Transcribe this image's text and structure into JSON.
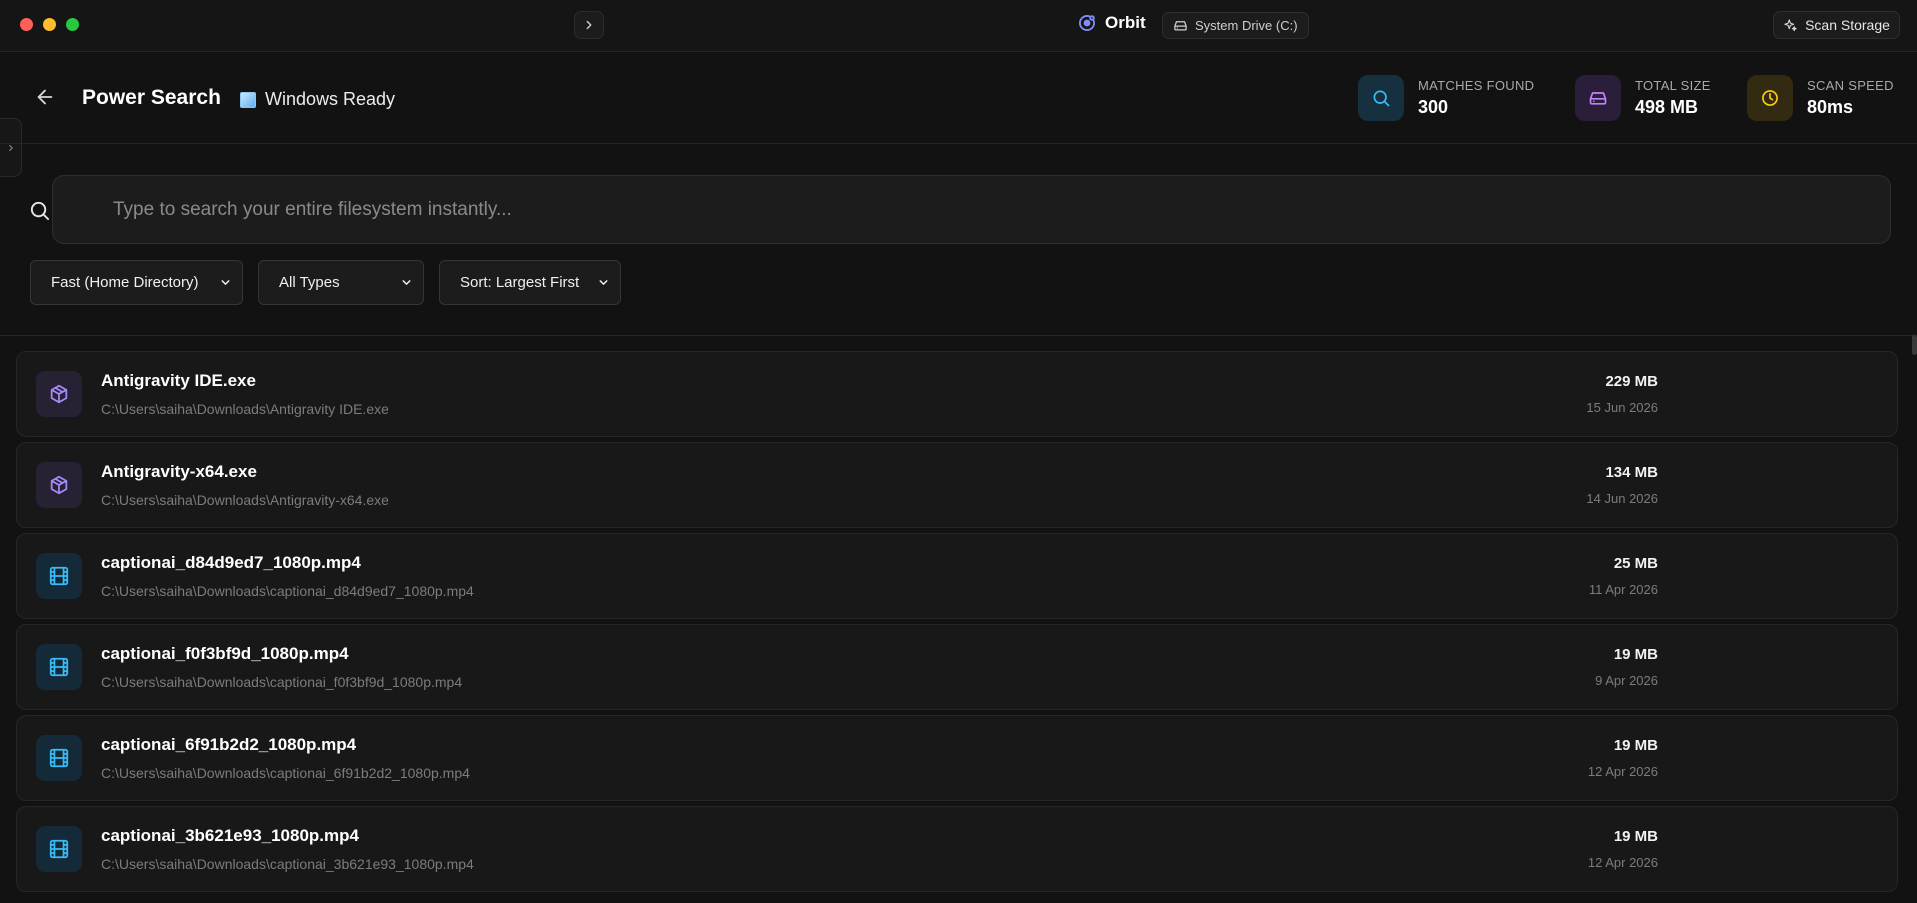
{
  "titlebar": {
    "app_name": "Orbit",
    "drive_label": "System Drive (C:)",
    "scan_button_label": "Scan Storage"
  },
  "header": {
    "title": "Power Search",
    "os_status": "Windows Ready",
    "stats": [
      {
        "label": "MATCHES FOUND",
        "value": "300",
        "icon": "search-icon",
        "color": "#38bdf8"
      },
      {
        "label": "TOTAL SIZE",
        "value": "498 MB",
        "icon": "drive-icon",
        "color": "#c084fc"
      },
      {
        "label": "SCAN SPEED",
        "value": "80ms",
        "icon": "clock-icon",
        "color": "#facc15"
      }
    ]
  },
  "search": {
    "placeholder": "Type to search your entire filesystem instantly...",
    "value": ""
  },
  "filters": {
    "scope": "Fast (Home Directory)",
    "type": "All Types",
    "sort": "Sort: Largest First"
  },
  "results": [
    {
      "name": "Antigravity IDE.exe",
      "path": "C:\\Users\\saiha\\Downloads\\Antigravity IDE.exe",
      "size": "229 MB",
      "date": "15 Jun 2026",
      "kind": "package-icon"
    },
    {
      "name": "Antigravity-x64.exe",
      "path": "C:\\Users\\saiha\\Downloads\\Antigravity-x64.exe",
      "size": "134 MB",
      "date": "14 Jun 2026",
      "kind": "package-icon"
    },
    {
      "name": "captionai_d84d9ed7_1080p.mp4",
      "path": "C:\\Users\\saiha\\Downloads\\captionai_d84d9ed7_1080p.mp4",
      "size": "25 MB",
      "date": "11 Apr 2026",
      "kind": "video-icon"
    },
    {
      "name": "captionai_f0f3bf9d_1080p.mp4",
      "path": "C:\\Users\\saiha\\Downloads\\captionai_f0f3bf9d_1080p.mp4",
      "size": "19 MB",
      "date": "9 Apr 2026",
      "kind": "video-icon"
    },
    {
      "name": "captionai_6f91b2d2_1080p.mp4",
      "path": "C:\\Users\\saiha\\Downloads\\captionai_6f91b2d2_1080p.mp4",
      "size": "19 MB",
      "date": "12 Apr 2026",
      "kind": "video-icon"
    },
    {
      "name": "captionai_3b621e93_1080p.mp4",
      "path": "C:\\Users\\saiha\\Downloads\\captionai_3b621e93_1080p.mp4",
      "size": "19 MB",
      "date": "12 Apr 2026",
      "kind": "video-icon"
    }
  ]
}
